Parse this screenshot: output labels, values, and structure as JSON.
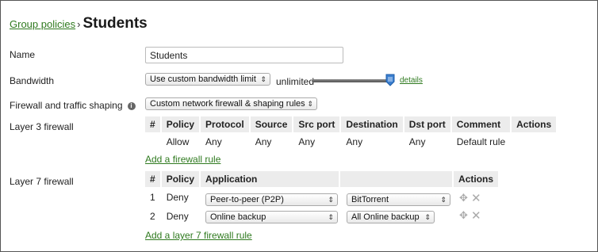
{
  "breadcrumb": {
    "parent": "Group policies",
    "separator": "›",
    "title": "Students"
  },
  "name": {
    "label": "Name",
    "value": "Students"
  },
  "bandwidth": {
    "label": "Bandwidth",
    "select_value": "Use custom bandwidth limit",
    "limit_text": "unlimited",
    "details_link": "details",
    "slider_level": 1.0
  },
  "firewall_shaping": {
    "label": "Firewall and traffic shaping",
    "select_value": "Custom network firewall & shaping rules"
  },
  "layer3": {
    "label": "Layer 3 firewall",
    "headers": [
      "#",
      "Policy",
      "Protocol",
      "Source",
      "Src port",
      "Destination",
      "Dst port",
      "Comment",
      "Actions"
    ],
    "rows": [
      {
        "num": "",
        "policy": "Allow",
        "protocol": "Any",
        "source": "Any",
        "src_port": "Any",
        "destination": "Any",
        "dst_port": "Any",
        "comment": "Default rule"
      }
    ],
    "add_link": "Add a firewall rule"
  },
  "layer7": {
    "label": "Layer 7 firewall",
    "headers": [
      "#",
      "Policy",
      "Application",
      "",
      "Actions"
    ],
    "rows": [
      {
        "num": "1",
        "policy": "Deny",
        "category": "Peer-to-peer (P2P)",
        "application": "BitTorrent"
      },
      {
        "num": "2",
        "policy": "Deny",
        "category": "Online backup",
        "application": "All Online backup"
      }
    ],
    "add_link": "Add a layer 7 firewall rule"
  },
  "colors": {
    "link": "#2f7a1f",
    "header_bg": "#ececec",
    "slider_thumb": "#3b7fd0"
  },
  "icons": {
    "move": "move-arrows-icon",
    "delete": "delete-x-icon",
    "info": "info-icon"
  }
}
